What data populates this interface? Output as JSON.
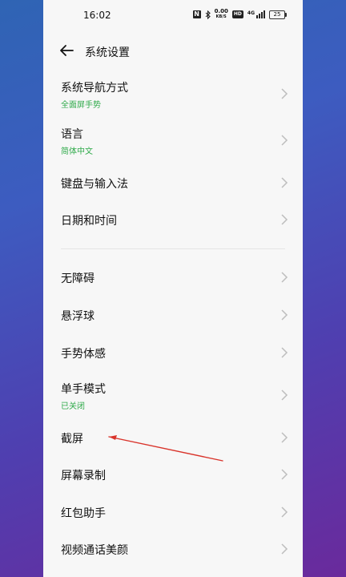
{
  "status_bar": {
    "time": "16:02",
    "nfc": "N",
    "speed_value": "0.00",
    "speed_unit": "KB/S",
    "hd": "HD",
    "network": "4G",
    "battery": "25"
  },
  "header": {
    "title": "系统设置"
  },
  "settings": {
    "items": [
      {
        "label": "系统导航方式",
        "sublabel": "全面屏手势"
      },
      {
        "label": "语言",
        "sublabel": "简体中文"
      },
      {
        "label": "键盘与输入法"
      },
      {
        "label": "日期和时间"
      },
      {
        "label": "无障碍"
      },
      {
        "label": "悬浮球"
      },
      {
        "label": "手势体感"
      },
      {
        "label": "单手模式",
        "sublabel": "已关闭"
      },
      {
        "label": "截屏"
      },
      {
        "label": "屏幕录制"
      },
      {
        "label": "红包助手"
      },
      {
        "label": "视频通话美颜"
      }
    ]
  },
  "colors": {
    "accent_green": "#2faa4a",
    "annotation_red": "#d9342b"
  },
  "icons": {
    "back": "arrow-left-icon",
    "chevron": "chevron-right-icon"
  }
}
